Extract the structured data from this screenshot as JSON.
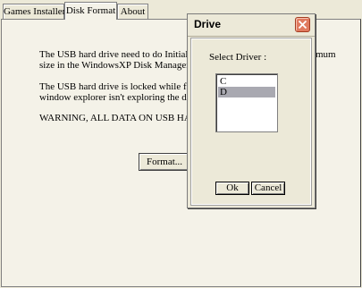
{
  "tabs": [
    {
      "label": "Games Installer",
      "active": false
    },
    {
      "label": "Disk Format",
      "active": true
    },
    {
      "label": "About",
      "active": false
    }
  ],
  "disk_format": {
    "paragraph1": "The USB hard drive need to do Initialize an\nsize in the WindowsXP Disk Management",
    "paragraph1_tail": "mum",
    "paragraph2": "The USB hard drive is locked while formatt\nwindow explorer isn't exploring the device!",
    "paragraph3": "WARNING, ALL DATA ON USB HARD",
    "format_button_label": "Format..."
  },
  "dialog": {
    "title": "Drive",
    "close_icon": "close-x-icon",
    "select_label": "Select Driver :",
    "drives": [
      "C",
      "D"
    ],
    "selected_drive": "D",
    "ok_label": "Ok",
    "cancel_label": "Cancel"
  },
  "colors": {
    "close_button": "#e07a5f",
    "selection": "#a9a9b1",
    "window_bg": "#ece9d8"
  }
}
